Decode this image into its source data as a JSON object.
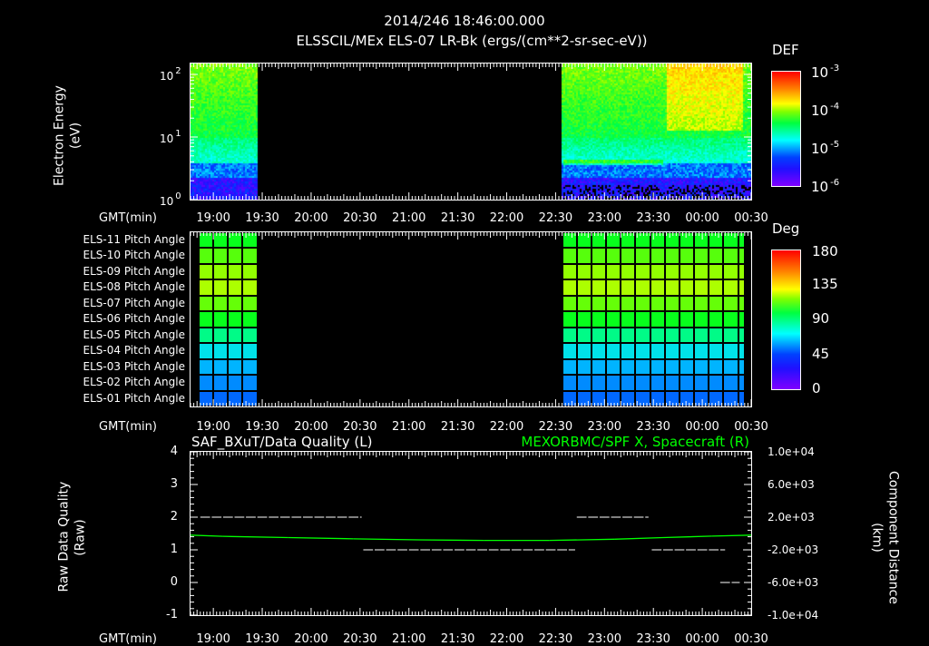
{
  "title": "2014/246 18:46:00.000",
  "subtitle": "ELSSCIL/MEx ELS-07 LR-Bk  (ergs/(cm**2-sr-sec-eV))",
  "time_axis_label": "GMT(min)",
  "time_ticks": [
    "19:00",
    "19:30",
    "20:00",
    "20:30",
    "21:00",
    "21:30",
    "22:00",
    "22:30",
    "23:00",
    "23:30",
    "00:00",
    "00:30"
  ],
  "chart_data": [
    {
      "type": "heatmap",
      "name": "energy-spectrogram",
      "ylabel": "Electron Energy",
      "yunit": "(eV)",
      "yscale": "log",
      "ylim": [
        1,
        150
      ],
      "yticks": [
        {
          "base": "10",
          "exp": "2"
        },
        {
          "base": "10",
          "exp": "1"
        },
        {
          "base": "10",
          "exp": "0"
        }
      ],
      "xlim_minutes_from_1846": [
        0,
        344
      ],
      "data_intervals": [
        [
          "18:46",
          "19:27"
        ],
        [
          "22:34",
          "00:30"
        ]
      ],
      "colorbar": {
        "label": "DEF",
        "scale": "log",
        "range": [
          1e-06,
          0.001
        ],
        "ticks": [
          {
            "base": "10",
            "exp": "-3"
          },
          {
            "base": "10",
            "exp": "-4"
          },
          {
            "base": "10",
            "exp": "-5"
          },
          {
            "base": "10",
            "exp": "-6"
          }
        ]
      }
    },
    {
      "type": "heatmap",
      "name": "pitch-angle",
      "rows": [
        "ELS-11 Pitch Angle",
        "ELS-10 Pitch Angle",
        "ELS-09 Pitch Angle",
        "ELS-08 Pitch Angle",
        "ELS-07 Pitch Angle",
        "ELS-06 Pitch Angle",
        "ELS-05 Pitch Angle",
        "ELS-04 Pitch Angle",
        "ELS-03 Pitch Angle",
        "ELS-02 Pitch Angle",
        "ELS-01 Pitch Angle"
      ],
      "row_values_deg": [
        100,
        110,
        118,
        122,
        112,
        100,
        88,
        75,
        65,
        58,
        52
      ],
      "data_intervals": [
        [
          "18:46",
          "19:27"
        ],
        [
          "22:34",
          "00:30"
        ]
      ],
      "colorbar": {
        "label": "Deg",
        "range": [
          0,
          180
        ],
        "ticks": [
          "180",
          "135",
          "90",
          "45",
          "0"
        ]
      }
    },
    {
      "type": "line",
      "name": "data-quality-and-position",
      "left_title": "SAF_BXuT/Data Quality (L)",
      "right_title": "MEXORBMC/SPF X, Spacecraft (R)",
      "ylabel_left": "Raw Data Quality",
      "yunit_left": "(Raw)",
      "ylabel_right": "Component Distance",
      "yunit_right": "(km)",
      "ylim_left": [
        -1,
        4
      ],
      "yticks_left": [
        "4",
        "3",
        "2",
        "1",
        "0",
        "-1"
      ],
      "ylim_right": [
        -10000,
        10000
      ],
      "yticks_right": [
        "1.0e+04",
        "6.0e+03",
        "2.0e+03",
        "-2.0e+03",
        "-6.0e+03",
        "-1.0e+04"
      ],
      "series": [
        {
          "name": "Data Quality",
          "color": "#ffffff",
          "segments": [
            {
              "start_min": 6,
              "end_min": 105,
              "value": 2
            },
            {
              "start_min": 106,
              "end_min": 236,
              "value": 1
            },
            {
              "start_min": 237,
              "end_min": 281,
              "value": 2
            },
            {
              "start_min": 283,
              "end_min": 328,
              "value": 1
            },
            {
              "start_min": 325,
              "end_min": 337,
              "value": 0
            },
            {
              "start_min": 339,
              "end_min": 340,
              "value": 1
            }
          ]
        },
        {
          "name": "SPF X, Spacecraft (km)",
          "color": "#00ff00",
          "x_min": [
            0,
            20,
            60,
            100,
            140,
            180,
            220,
            260,
            290,
            320,
            344
          ],
          "values": [
            -200,
            -350,
            -500,
            -650,
            -780,
            -850,
            -850,
            -700,
            -500,
            -320,
            -200
          ]
        }
      ]
    }
  ]
}
